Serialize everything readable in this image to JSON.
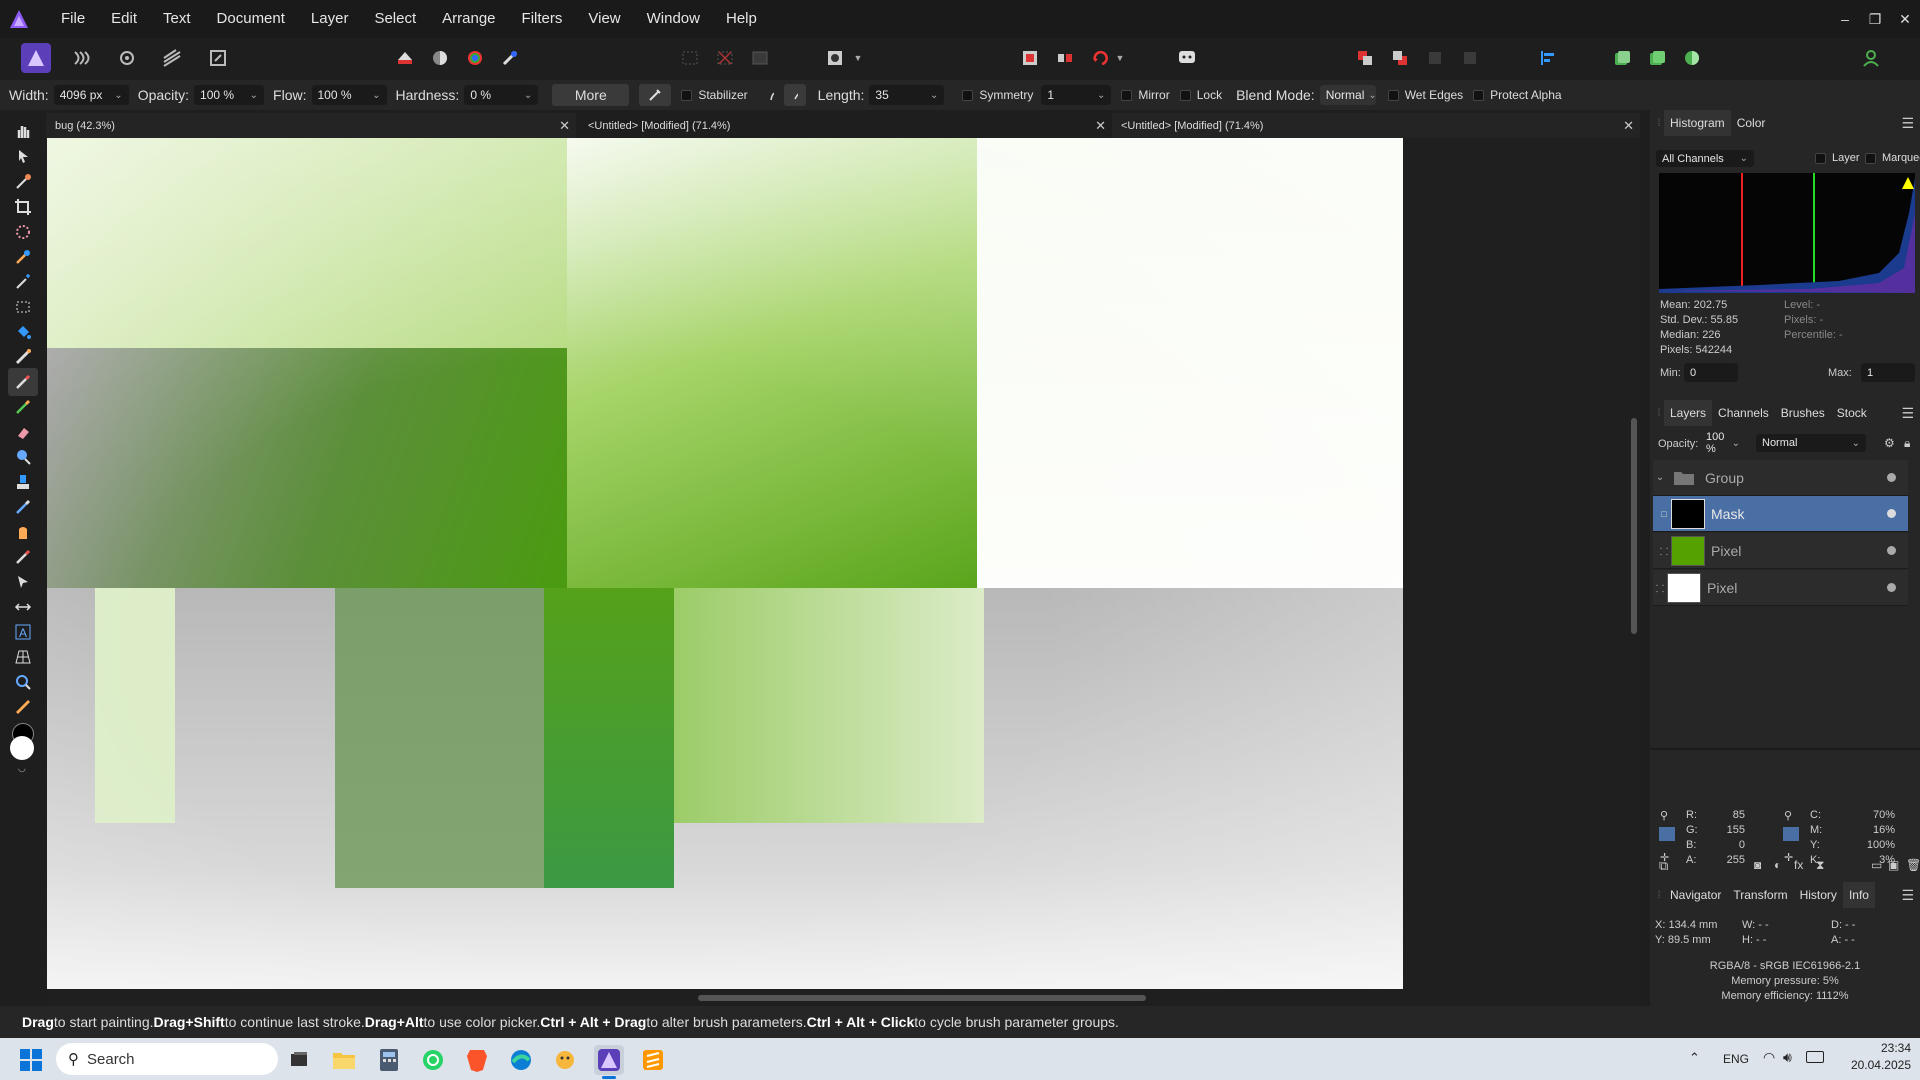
{
  "menu": {
    "items": [
      "File",
      "Edit",
      "Text",
      "Document",
      "Layer",
      "Select",
      "Arrange",
      "Filters",
      "View",
      "Window",
      "Help"
    ]
  },
  "context": {
    "width_label": "Width:",
    "width_value": "4096 px",
    "opacity_label": "Opacity:",
    "opacity_value": "100 %",
    "flow_label": "Flow:",
    "flow_value": "100 %",
    "hardness_label": "Hardness:",
    "hardness_value": "0 %",
    "more_label": "More",
    "stabilizer_label": "Stabilizer",
    "length_label": "Length:",
    "length_value": "35",
    "symmetry_label": "Symmetry",
    "symmetry_value": "1",
    "mirror_label": "Mirror",
    "lock_label": "Lock",
    "blend_label": "Blend Mode:",
    "blend_value": "Normal",
    "wet_edges_label": "Wet Edges",
    "protect_alpha_label": "Protect Alpha"
  },
  "tabs": [
    {
      "label": "bug (42.3%)"
    },
    {
      "label": "<Untitled> [Modified] (71.4%)"
    },
    {
      "label": "<Untitled> [Modified] (71.4%)"
    }
  ],
  "histogram": {
    "tabs": [
      "Histogram",
      "Color"
    ],
    "channels": "All Channels",
    "layer_label": "Layer",
    "marquee_label": "Marquee",
    "mean": "Mean: 202.75",
    "stddev": "Std. Dev.: 55.85",
    "median": "Median: 226",
    "pixels": "Pixels: 542244",
    "level": "Level: -",
    "pixels2": "Pixels: -",
    "percentile": "Percentile: -",
    "min_label": "Min:",
    "min_value": "0",
    "max_label": "Max:",
    "max_value": "1"
  },
  "layers": {
    "tabs": [
      "Layers",
      "Channels",
      "Brushes",
      "Stock"
    ],
    "opacity_label": "Opacity:",
    "opacity_value": "100 %",
    "blend_value": "Normal",
    "items": [
      {
        "name": "Group"
      },
      {
        "name": "Mask"
      },
      {
        "name": "Pixel"
      },
      {
        "name": "Pixel"
      }
    ]
  },
  "info": {
    "tabs": [
      "Navigator",
      "Transform",
      "History",
      "Info"
    ],
    "r_label": "R:",
    "r": "85",
    "g_label": "G:",
    "g": "155",
    "b_label": "B:",
    "b": "0",
    "a_label": "A:",
    "a": "255",
    "c_label": "C:",
    "c": "70%",
    "m_label": "M:",
    "m": "16%",
    "y_label": "Y:",
    "y": "100%",
    "k_label": "K:",
    "k": "3%",
    "x": "X: 134.4 mm",
    "y_pos": "Y: 89.5 mm",
    "w": "W: - -",
    "h": "H: - -",
    "d": "D: - -",
    "angle": "A: - -",
    "color_profile": "RGBA/8 - sRGB IEC61966-2.1",
    "memory_pressure": "Memory pressure: 5%",
    "memory_efficiency": "Memory efficiency: 1112%"
  },
  "status": {
    "k1": "Drag",
    "t1": " to start painting. ",
    "k2": "Drag+Shift",
    "t2": " to continue last stroke. ",
    "k3": "Drag+Alt",
    "t3": " to use color picker. ",
    "k4": "Ctrl + Alt + Drag",
    "t4": " to alter brush parameters. ",
    "k5": "Ctrl + Alt + Click",
    "t5": " to cycle brush parameter groups."
  },
  "taskbar": {
    "search_placeholder": "Search",
    "lang": "ENG",
    "time": "23:34",
    "date": "20.04.2025"
  },
  "colors": {
    "accent": "#4a6fa5",
    "green": "#55a100",
    "affinity": "#7c4dff"
  }
}
